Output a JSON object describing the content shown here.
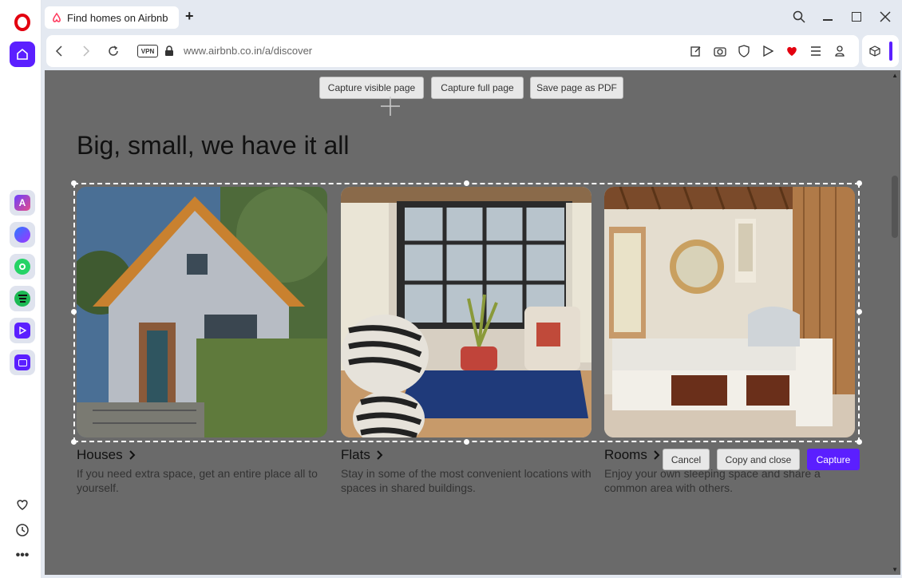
{
  "tab": {
    "title": "Find homes on Airbnb",
    "add": "+"
  },
  "address": {
    "vpn": "VPN",
    "url": "www.airbnb.co.in/a/discover"
  },
  "capture_toolbar": {
    "visible": "Capture visible page",
    "full": "Capture full page",
    "pdf": "Save page as PDF"
  },
  "page": {
    "heading": "Big, small, we have it all",
    "cards": [
      {
        "title": "Houses",
        "desc": "If you need extra space, get an entire place all to yourself."
      },
      {
        "title": "Flats",
        "desc": "Stay in some of the most convenient locations with spaces in shared buildings."
      },
      {
        "title": "Rooms",
        "desc": "Enjoy your own sleeping space and share a common area with others."
      }
    ]
  },
  "actions": {
    "cancel": "Cancel",
    "copy": "Copy and close",
    "capture": "Capture"
  },
  "colors": {
    "accent": "#5b1fff",
    "opera_red": "#e3000f",
    "airbnb": "#ff385c",
    "overlay": "#6a6a6a"
  }
}
